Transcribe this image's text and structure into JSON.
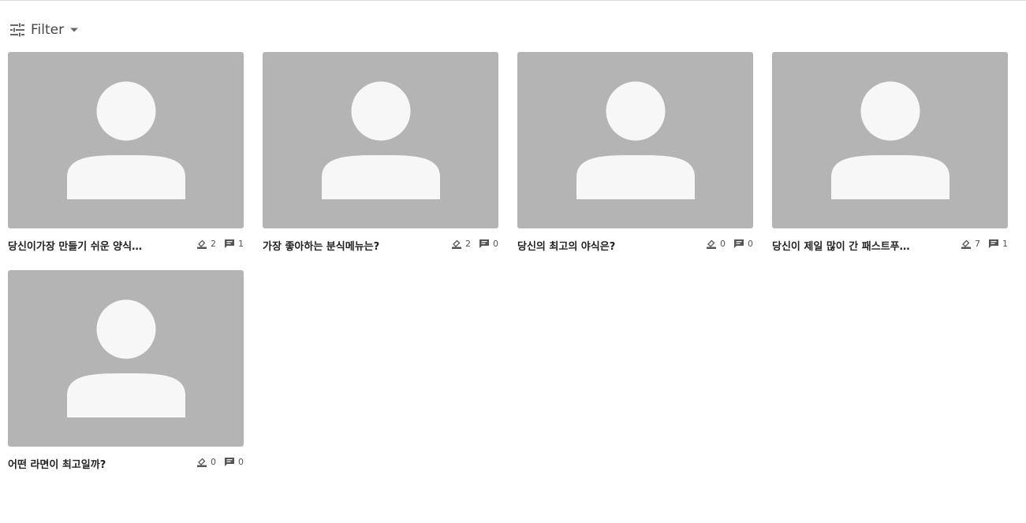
{
  "filter": {
    "label": "Filter",
    "icon": "tune-icon"
  },
  "cards": [
    {
      "title": "당신이가장 만들기 쉬운 양식은?",
      "votes": "2",
      "comments": "1"
    },
    {
      "title": "가장 좋아하는 분식메뉴는?",
      "votes": "2",
      "comments": "0"
    },
    {
      "title": "당신의 최고의 야식은?",
      "votes": "0",
      "comments": "0"
    },
    {
      "title": "당신이 제일 많이 간 패스트푸…",
      "votes": "7",
      "comments": "1"
    },
    {
      "title": "어떤 라면이 최고일까?",
      "votes": "0",
      "comments": "0"
    }
  ],
  "colors": {
    "thumb_bg": "#b4b4b4",
    "avatar_fill": "#f7f7f7"
  }
}
